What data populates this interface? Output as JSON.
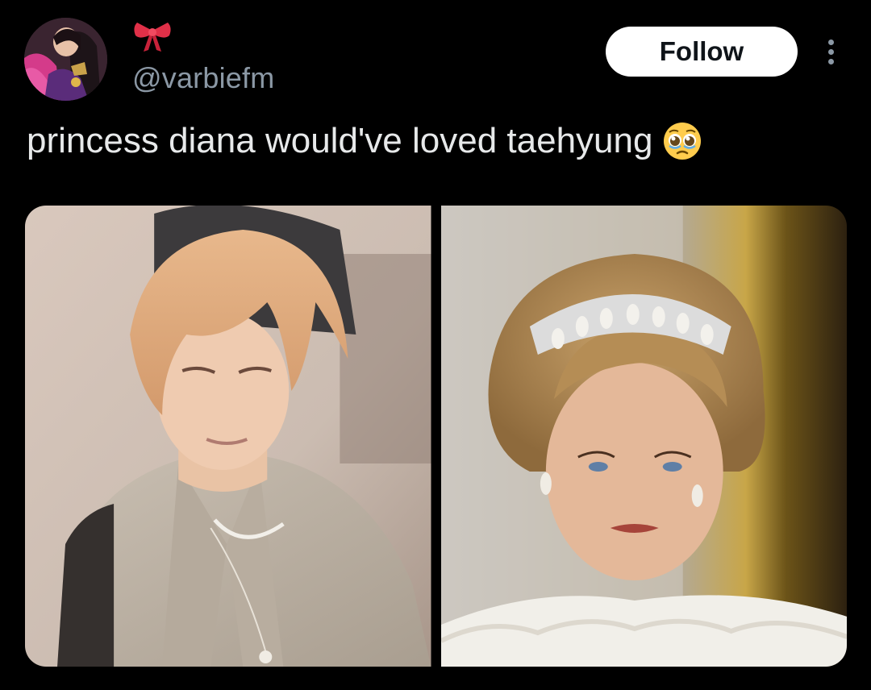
{
  "tweet": {
    "author": {
      "display_name_icon": "ribbon-bow-emoji",
      "handle": "@varbiefm",
      "avatar_icon": "profile-avatar"
    },
    "follow_label": "Follow",
    "more_icon": "more-options-icon",
    "text": "princess diana would've loved taehyung",
    "text_emoji": "pleading-face-emoji",
    "media": [
      {
        "description_icon": "photo-left"
      },
      {
        "description_icon": "photo-right"
      }
    ]
  },
  "colors": {
    "background": "#000000",
    "text": "#e7e9ea",
    "secondary_text": "#8b98a5",
    "follow_button_bg": "#ffffff",
    "follow_button_text": "#0f1419"
  }
}
